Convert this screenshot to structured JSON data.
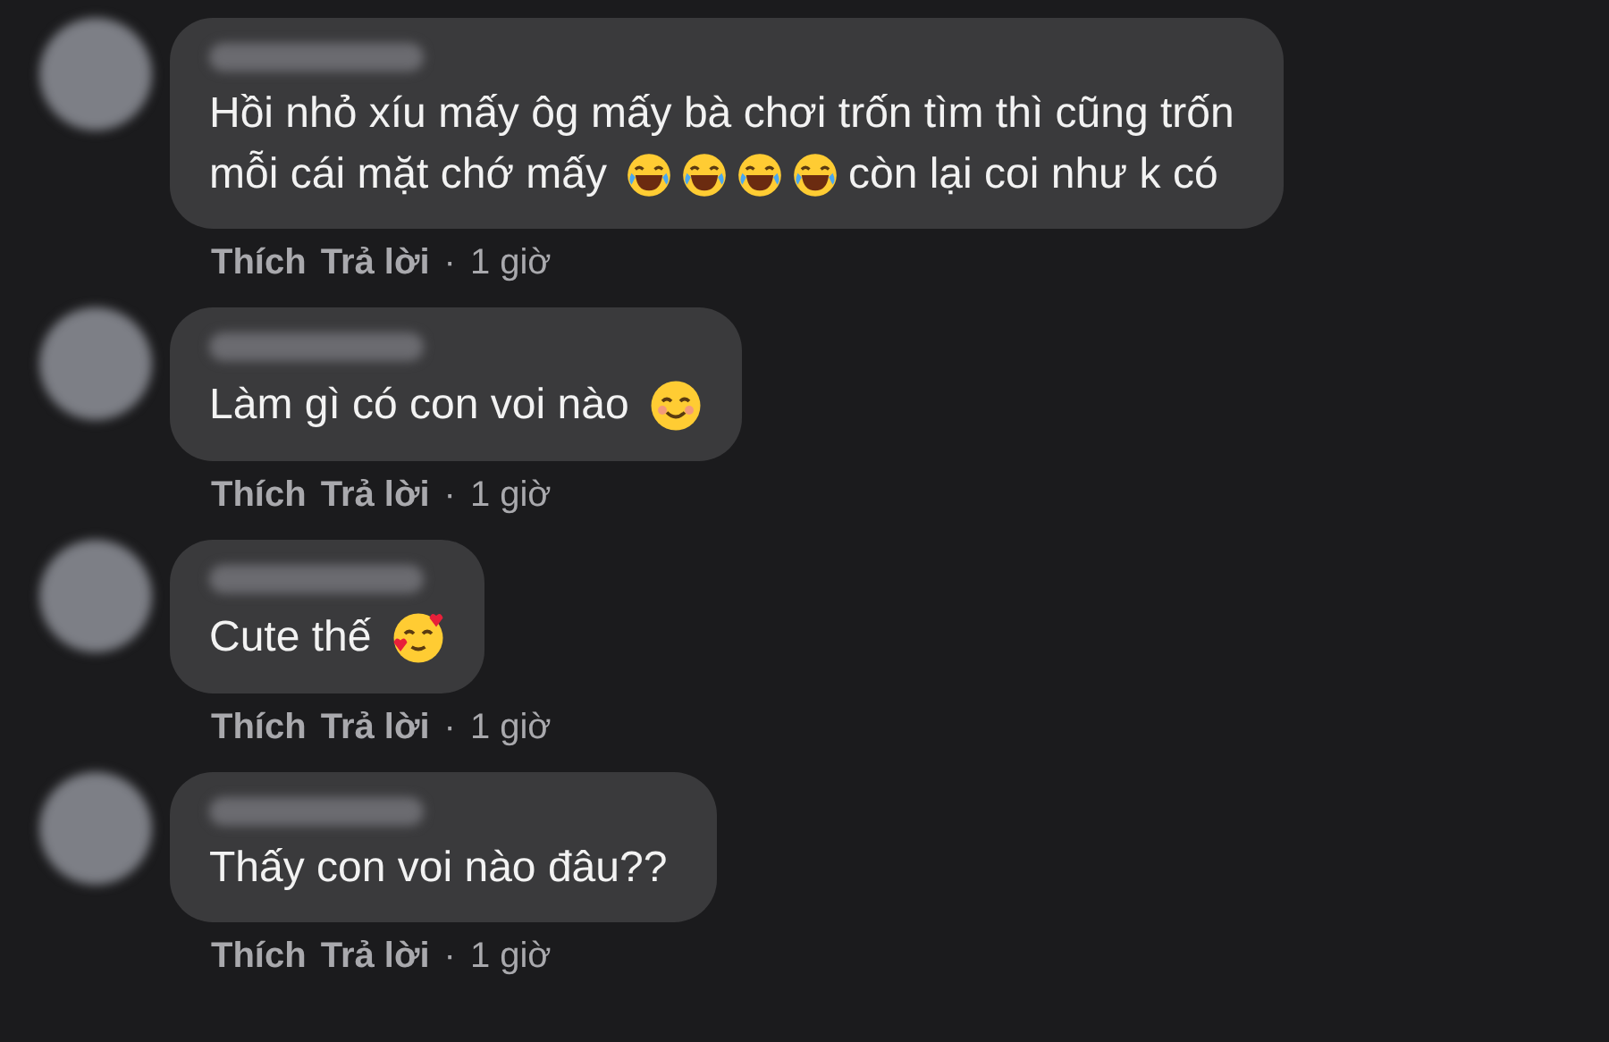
{
  "comments": [
    {
      "lines": [
        [
          {
            "kind": "text",
            "text": "Hồi nhỏ xíu mấy ôg mấy bà chơi trốn tìm thì cũng trốn"
          }
        ],
        [
          {
            "kind": "text",
            "text": "mỗi cái mặt chớ mấy"
          },
          {
            "kind": "laugh"
          },
          {
            "kind": "laugh"
          },
          {
            "kind": "laugh"
          },
          {
            "kind": "laugh"
          },
          {
            "kind": "text",
            "text": "còn lại coi như k có"
          }
        ]
      ],
      "like": "Thích",
      "reply": "Trả lời",
      "dot": "·",
      "time": "1 giờ"
    },
    {
      "lines": [
        [
          {
            "kind": "text",
            "text": "Làm gì có con voi nào"
          },
          {
            "kind": "smile"
          }
        ]
      ],
      "like": "Thích",
      "reply": "Trả lời",
      "dot": "·",
      "time": "1 giờ"
    },
    {
      "lines": [
        [
          {
            "kind": "text",
            "text": "Cute thế"
          },
          {
            "kind": "love"
          }
        ]
      ],
      "like": "Thích",
      "reply": "Trả lời",
      "dot": "·",
      "time": "1 giờ"
    },
    {
      "lines": [
        [
          {
            "kind": "text",
            "text": "Thấy con voi nào đâu??"
          }
        ]
      ],
      "like": "Thích",
      "reply": "Trả lời",
      "dot": "·",
      "time": "1 giờ"
    }
  ]
}
